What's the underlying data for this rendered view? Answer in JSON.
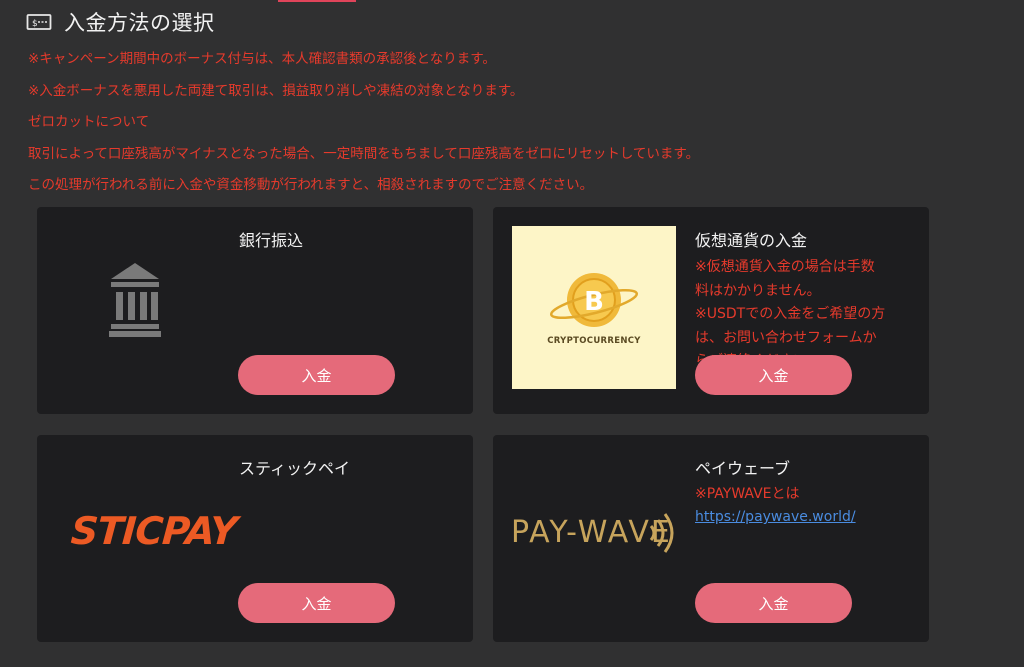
{
  "header": {
    "title": "入金方法の選択",
    "icon": "cash-icon"
  },
  "notes": [
    "※キャンペーン期間中のボーナス付与は、本人確認書類の承認後となります。",
    "※入金ボーナスを悪用した両建て取引は、損益取り消しや凍結の対象となります。",
    "ゼロカットについて",
    "取引によって口座残高がマイナスとなった場合、一定時間をもちまして口座残高をゼロにリセットしています。",
    "この処理が行われる前に入金や資金移動が行われますと、相殺されますのでご注意ください。"
  ],
  "methods": [
    {
      "title": "銀行振込",
      "icon": "bank-icon",
      "button": "入金"
    },
    {
      "title": "仮想通貨の入金",
      "image_caption": "CRYPTOCURRENCY",
      "coin_symbol": "B",
      "notes": [
        "※仮想通貨入金の場合は手数",
        "料はかかりません。",
        "※USDTでの入金をご希望の方",
        "は、お問い合わせフォームか",
        "らご連絡ください。"
      ],
      "button": "入金"
    },
    {
      "title": "スティックペイ",
      "logo": "STICPAY",
      "button": "入金"
    },
    {
      "title": "ペイウェーブ",
      "logo": "PAY-WAVE",
      "note": "※PAYWAVEとは",
      "link": "https://paywave.world/",
      "button": "入金"
    }
  ],
  "colors": {
    "background": "#303031",
    "card": "#1d1d1f",
    "warning_text": "#e53a2c",
    "button": "#e56a7a",
    "link": "#4a8ce0",
    "sticpay": "#ec5a24",
    "paywave": "#c7a45c"
  }
}
